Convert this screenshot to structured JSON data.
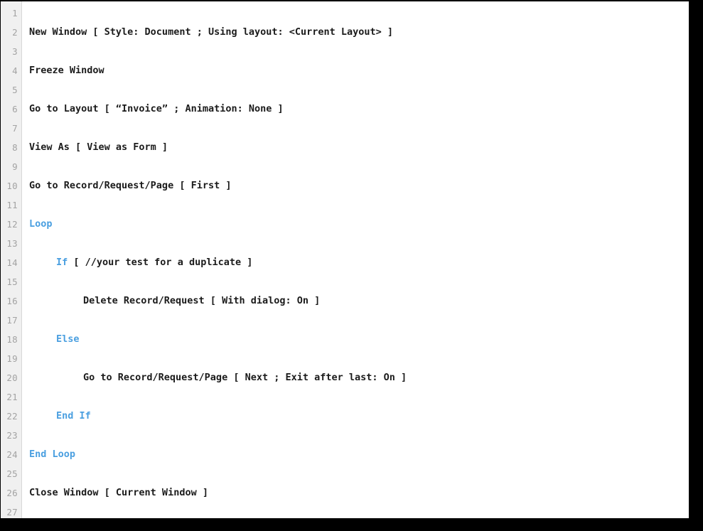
{
  "editor": {
    "kind": "script-workspace",
    "language": "FileMaker ScriptMaker",
    "keyword_color": "#4a9fe0",
    "text_color": "#1b1b1b",
    "gutter_color": "#f0f0f0",
    "line_number_color": "#a3a3a3",
    "background_color": "#ffffff",
    "frame_color": "#000000",
    "total_lines": 27,
    "lines": [
      {
        "number": "1",
        "indent": 0,
        "keyword": "",
        "text": ""
      },
      {
        "number": "2",
        "indent": 0,
        "keyword": "",
        "text": "New Window [ Style: Document ; Using layout: <Current Layout> ]"
      },
      {
        "number": "3",
        "indent": 0,
        "keyword": "",
        "text": ""
      },
      {
        "number": "4",
        "indent": 0,
        "keyword": "",
        "text": "Freeze Window"
      },
      {
        "number": "5",
        "indent": 0,
        "keyword": "",
        "text": ""
      },
      {
        "number": "6",
        "indent": 0,
        "keyword": "",
        "text": "Go to Layout [ “Invoice” ; Animation: None ]"
      },
      {
        "number": "7",
        "indent": 0,
        "keyword": "",
        "text": ""
      },
      {
        "number": "8",
        "indent": 0,
        "keyword": "",
        "text": "View As [ View as Form ]"
      },
      {
        "number": "9",
        "indent": 0,
        "keyword": "",
        "text": ""
      },
      {
        "number": "10",
        "indent": 0,
        "keyword": "",
        "text": "Go to Record/Request/Page [ First ]"
      },
      {
        "number": "11",
        "indent": 0,
        "keyword": "",
        "text": ""
      },
      {
        "number": "12",
        "indent": 0,
        "keyword": "Loop",
        "text": ""
      },
      {
        "number": "13",
        "indent": 0,
        "keyword": "",
        "text": ""
      },
      {
        "number": "14",
        "indent": 1,
        "keyword": "If",
        "text": " [ //your test for a duplicate ]"
      },
      {
        "number": "15",
        "indent": 0,
        "keyword": "",
        "text": ""
      },
      {
        "number": "16",
        "indent": 2,
        "keyword": "",
        "text": "Delete Record/Request [ With dialog: On ]"
      },
      {
        "number": "17",
        "indent": 0,
        "keyword": "",
        "text": ""
      },
      {
        "number": "18",
        "indent": 1,
        "keyword": "Else",
        "text": ""
      },
      {
        "number": "19",
        "indent": 0,
        "keyword": "",
        "text": ""
      },
      {
        "number": "20",
        "indent": 2,
        "keyword": "",
        "text": "Go to Record/Request/Page [ Next ; Exit after last: On ]"
      },
      {
        "number": "21",
        "indent": 0,
        "keyword": "",
        "text": ""
      },
      {
        "number": "22",
        "indent": 1,
        "keyword": "End If",
        "text": ""
      },
      {
        "number": "23",
        "indent": 0,
        "keyword": "",
        "text": ""
      },
      {
        "number": "24",
        "indent": 0,
        "keyword": "End Loop",
        "text": ""
      },
      {
        "number": "25",
        "indent": 0,
        "keyword": "",
        "text": ""
      },
      {
        "number": "26",
        "indent": 0,
        "keyword": "",
        "text": "Close Window [ Current Window ]"
      },
      {
        "number": "27",
        "indent": 0,
        "keyword": "",
        "text": ""
      }
    ]
  }
}
